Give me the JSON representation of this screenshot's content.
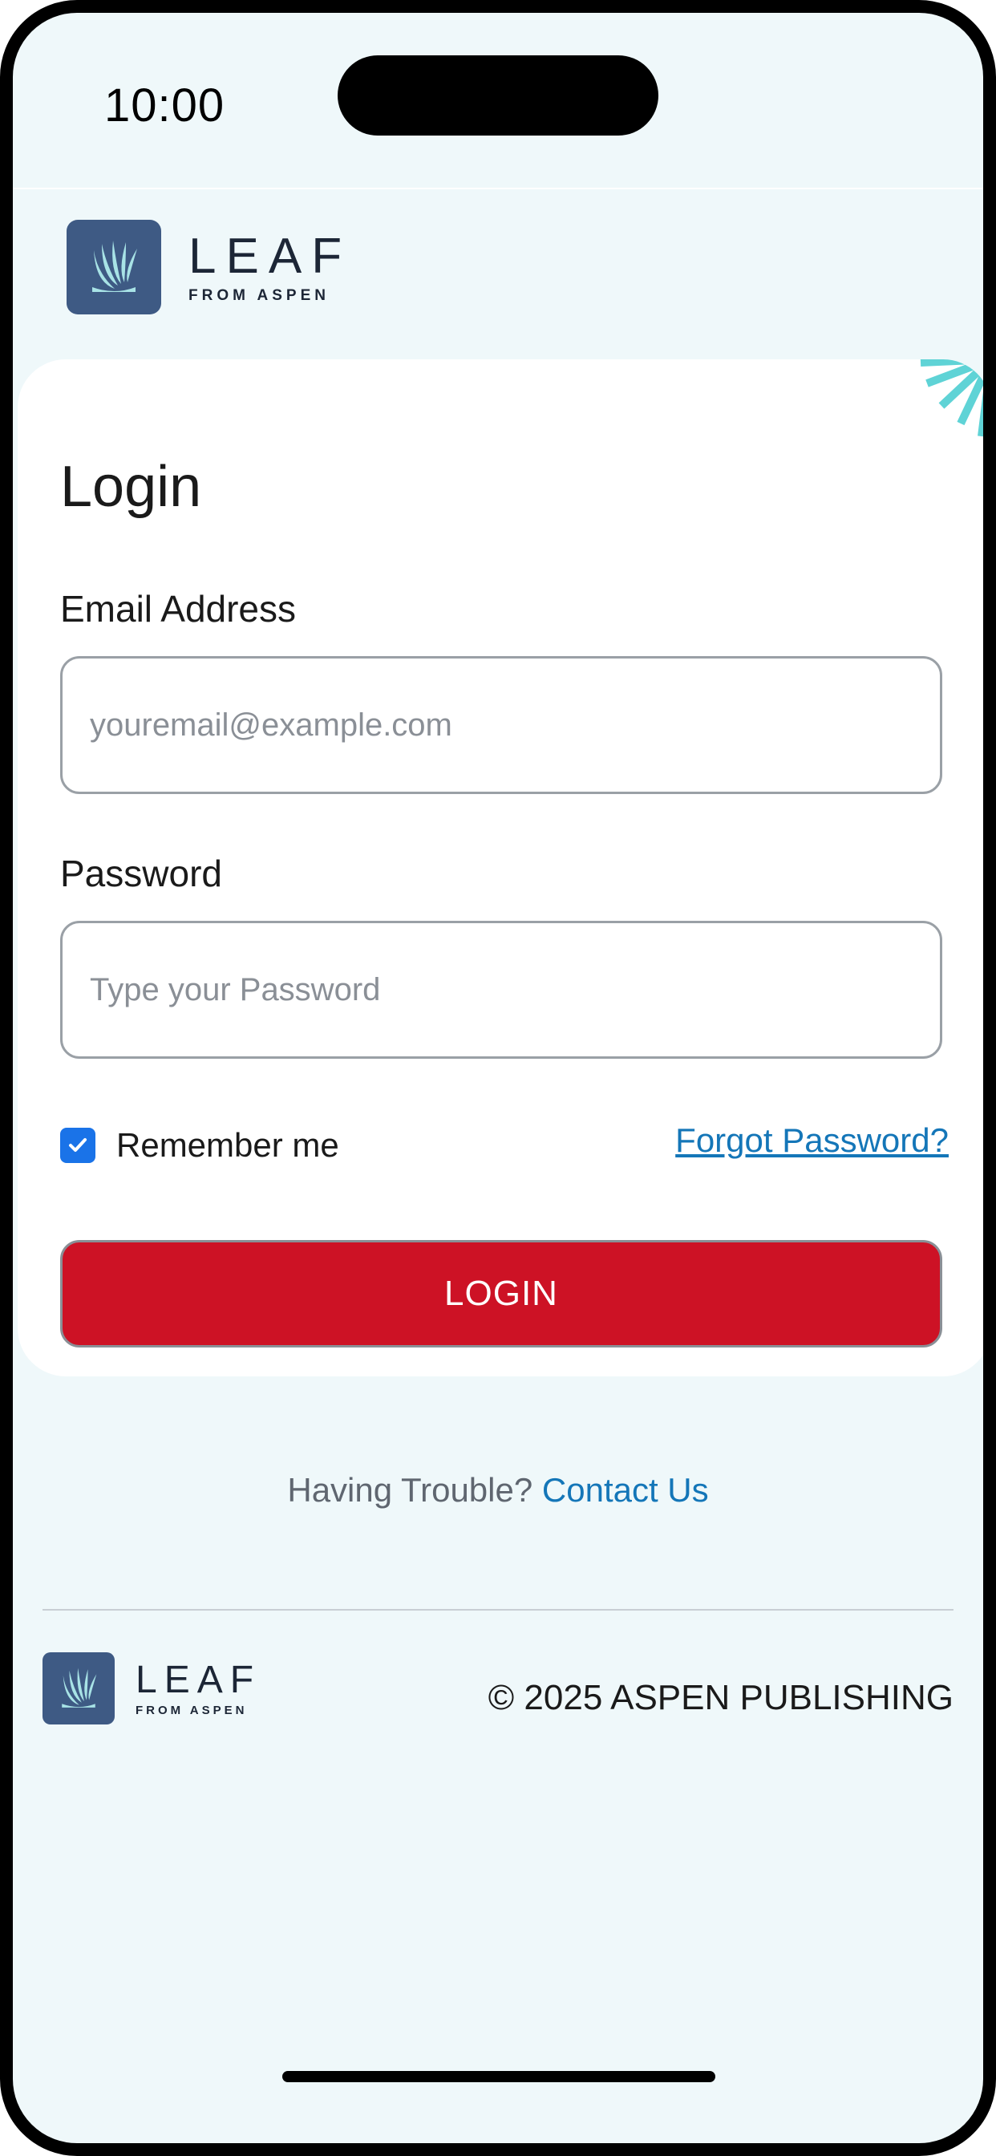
{
  "status_bar": {
    "time": "10:00"
  },
  "brand": {
    "name": "LEAF",
    "tagline": "FROM ASPEN"
  },
  "login": {
    "title": "Login",
    "email_label": "Email Address",
    "email_value": "",
    "email_placeholder": "youremail@example.com",
    "password_label": "Password",
    "password_value": "",
    "password_placeholder": "Type your Password",
    "remember_label": "Remember me",
    "remember_checked": true,
    "forgot_label": "Forgot Password?",
    "submit_label": "LOGIN"
  },
  "help": {
    "text": "Having Trouble?",
    "link": "Contact Us"
  },
  "footer": {
    "copyright": "© 2025 ASPEN PUBLISHING"
  },
  "colors": {
    "background": "#eff8fa",
    "brand_navy": "#3e5a84",
    "brand_teal": "#a8e3e6",
    "primary_button": "#cd1225",
    "link": "#1476b8",
    "checkbox": "#1a73e8"
  },
  "icons": [
    "leaf-logo-icon",
    "burst-decoration-icon",
    "checkmark-icon"
  ]
}
